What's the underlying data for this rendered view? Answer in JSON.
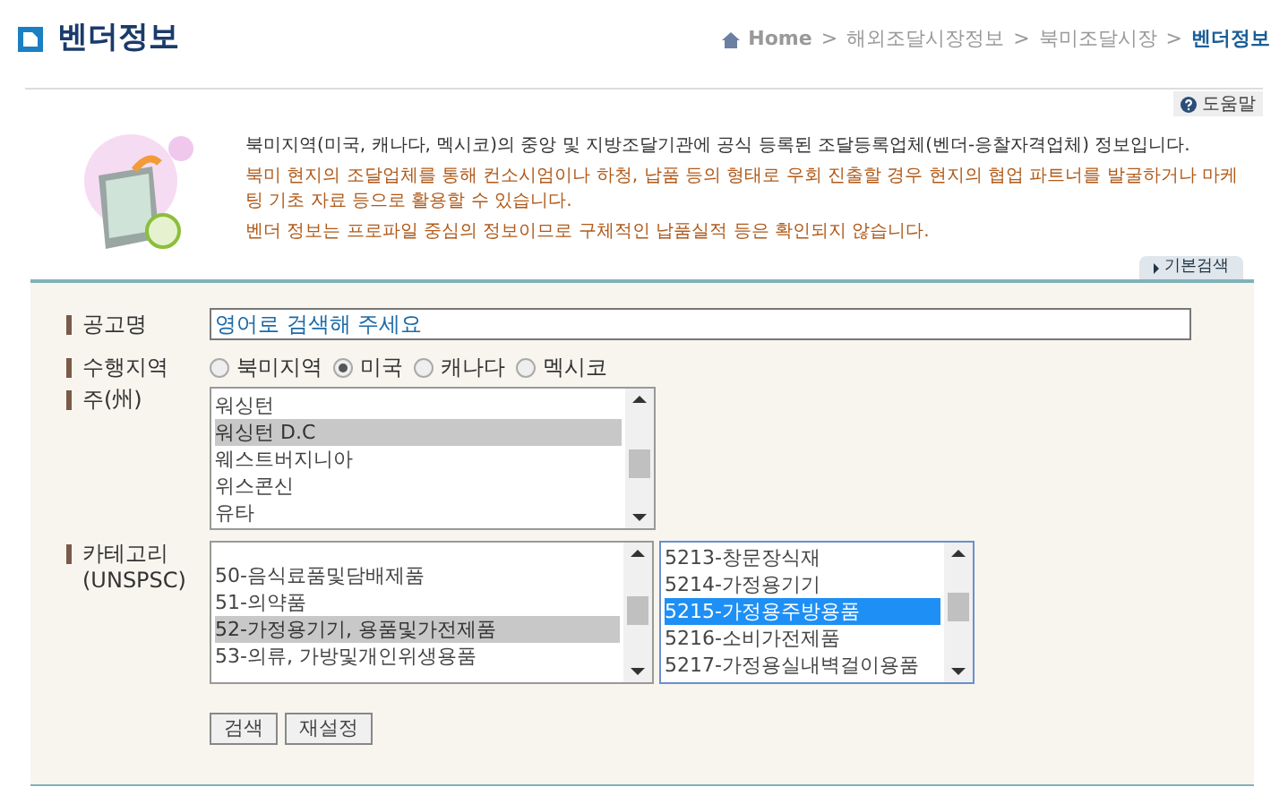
{
  "page_title": "벤더정보",
  "breadcrumb": [
    {
      "label": "Home",
      "kind": "home"
    },
    {
      "label": "해외조달시장정보",
      "kind": "link"
    },
    {
      "label": "북미조달시장",
      "kind": "link"
    },
    {
      "label": "벤더정보",
      "kind": "current"
    }
  ],
  "separator": ">",
  "help_button": "도움말",
  "intro": {
    "lead": "북미지역(미국, 캐나다, 멕시코)의 중앙 및 지방조달기관에 공식 등록된 조달등록업체(벤더-응찰자격업체) 정보입니다.",
    "notes": [
      "북미 현지의 조달업체를 통해 컨소시엄이나 하청, 납품 등의 형태로 우회 진출할 경우 현지의 협업 파트너를 발굴하거나 마케팅 기초 자료 등으로 활용할 수 있습니다.",
      "벤더 정보는 프로파일 중심의 정보이므로 구체적인 납품실적 등은 확인되지 않습니다."
    ]
  },
  "search_tab": "기본검색",
  "form": {
    "title_field": {
      "label": "공고명",
      "value": "영어로 검색해 주세요"
    },
    "region": {
      "label": "수행지역",
      "options": [
        {
          "label": "북미지역",
          "selected": false
        },
        {
          "label": "미국",
          "selected": true
        },
        {
          "label": "캐나다",
          "selected": false
        },
        {
          "label": "멕시코",
          "selected": false
        }
      ]
    },
    "state": {
      "label": "주(州)",
      "items": [
        {
          "label": "워싱턴",
          "selected": false
        },
        {
          "label": "워싱턴 D.C",
          "selected": true
        },
        {
          "label": "웨스트버지니아",
          "selected": false
        },
        {
          "label": "위스콘신",
          "selected": false
        },
        {
          "label": "유타",
          "selected": false
        }
      ]
    },
    "category": {
      "label": "카테고리",
      "sublabel": "(UNSPSC)",
      "items": [
        {
          "label": "50-음식료품및담배제품",
          "selected": false
        },
        {
          "label": "51-의약품",
          "selected": false
        },
        {
          "label": "52-가정용기기, 용품및가전제품",
          "selected": true
        },
        {
          "label": "53-의류, 가방및개인위생용품",
          "selected": false
        }
      ],
      "subitems": [
        {
          "label": "5213-창문장식재",
          "selected": false
        },
        {
          "label": "5214-가정용기기",
          "selected": false
        },
        {
          "label": "5215-가정용주방용품",
          "selected": true
        },
        {
          "label": "5216-소비가전제품",
          "selected": false
        },
        {
          "label": "5217-가정용실내벽걸이용품",
          "selected": false
        }
      ]
    },
    "buttons": [
      "검색",
      "재설정"
    ]
  }
}
